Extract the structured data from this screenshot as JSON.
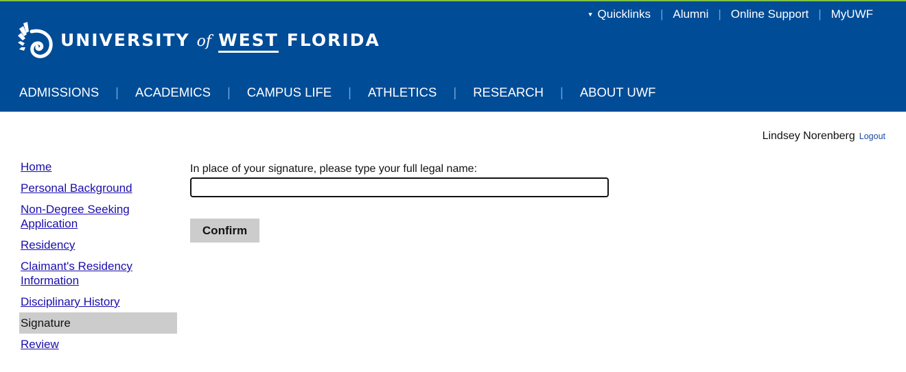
{
  "header": {
    "logo": {
      "university": "UNIVERSITY",
      "of": "of",
      "west": "WEST",
      "florida": "FLORIDA"
    },
    "quicklinks": {
      "label": "Quicklinks",
      "links": [
        "Alumni",
        "Online Support",
        "MyUWF"
      ]
    },
    "main_nav": [
      "ADMISSIONS",
      "ACADEMICS",
      "CAMPUS LIFE",
      "ATHLETICS",
      "RESEARCH",
      "ABOUT UWF"
    ],
    "colors": {
      "background": "#004c97",
      "accent_stripe": "#7ec242"
    }
  },
  "user": {
    "name": "Lindsey Norenberg",
    "logout_label": "Logout"
  },
  "sidebar": {
    "items": [
      {
        "label": "Home"
      },
      {
        "label": "Personal Background"
      },
      {
        "label": "Non-Degree Seeking Application"
      },
      {
        "label": "Residency"
      },
      {
        "label": "Claimant's Residency Information"
      },
      {
        "label": "Disciplinary History"
      },
      {
        "label": "Signature",
        "active": true
      },
      {
        "label": "Review"
      }
    ]
  },
  "form": {
    "signature_label": "In place of your signature, please type your full legal name:",
    "signature_value": "",
    "confirm_label": "Confirm"
  }
}
